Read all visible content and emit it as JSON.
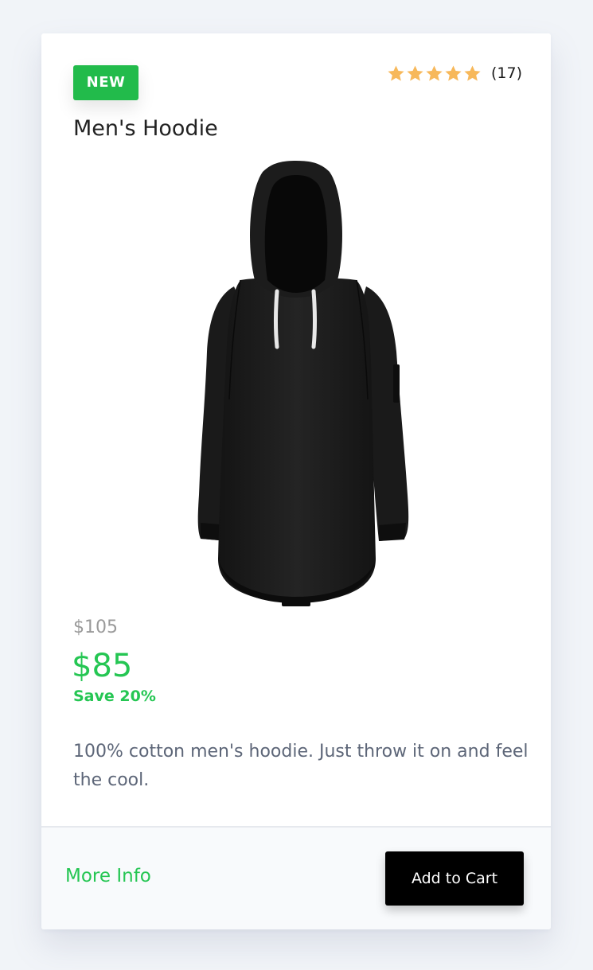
{
  "product": {
    "badge": "NEW",
    "rating": {
      "stars": 5,
      "count_label": "(17)",
      "star_color": "#f7b85a",
      "icon": "star-icon"
    },
    "title": "Men's Hoodie",
    "image": {
      "icon": "hoodie-image"
    },
    "old_price": "$105",
    "price": "$85",
    "savings": "Save 20%",
    "description": "100% cotton men's hoodie. Just throw it on and feel the cool."
  },
  "footer": {
    "more_info_label": "More Info",
    "add_to_cart_label": "Add to Cart"
  },
  "colors": {
    "accent": "#25c653",
    "badge_bg": "#22bb4b",
    "button_bg": "#000000",
    "page_bg": "#f1f4f8"
  }
}
